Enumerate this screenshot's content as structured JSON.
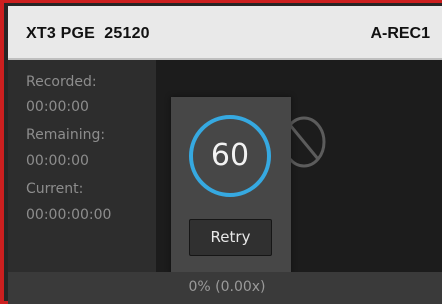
{
  "header": {
    "title": "XT3 PGE  25120",
    "channel": "A-REC1"
  },
  "info": {
    "recorded_label": "Recorded:",
    "recorded_value": "00:00:00",
    "remaining_label": "Remaining:",
    "remaining_value": "00:00:00",
    "current_label": "Current:",
    "current_value": "00:00:00:00"
  },
  "popup": {
    "countdown": "60",
    "retry_label": "Retry"
  },
  "status": {
    "progress_text": "0% (0.00x)"
  },
  "icons": {
    "preview": "no-signal-icon",
    "countdown": "countdown-ring-icon"
  },
  "colors": {
    "accent_border": "#cc1f1f",
    "countdown_ring": "#36a9e1"
  }
}
